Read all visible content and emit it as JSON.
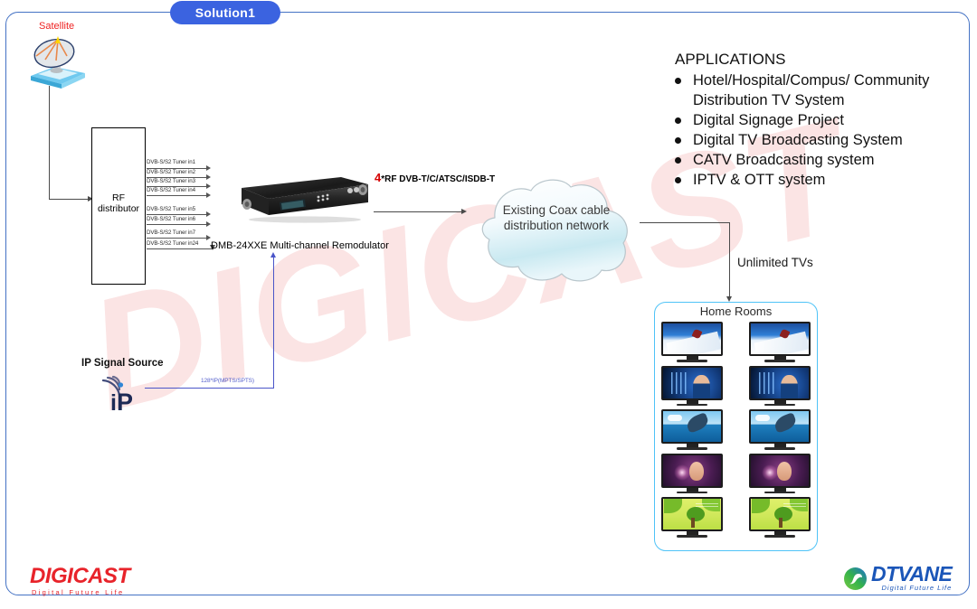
{
  "badge": {
    "label": "Solution1"
  },
  "satellite": {
    "label": "Satellite"
  },
  "rf_distributor": {
    "line1": "RF",
    "line2": "distributor"
  },
  "tuner_inputs": [
    "DVB-S/S2 Tuner in1",
    "DVB-S/S2 Tuner in2",
    "DVB-S/S2 Tuner in3",
    "DVB-S/S2 Tuner in4",
    "DVB-S/S2 Tuner in5",
    "DVB-S/S2 Tuner in6",
    "DVB-S/S2 Tuner in7",
    "DVB-S/S2 Tuner in24"
  ],
  "device": {
    "label": "DMB-24XXE Multi-channel Remodulator"
  },
  "rf_output": {
    "count": "4",
    "label": "*RF DVB-T/C/ATSC/ISDB-T"
  },
  "cloud": {
    "line1": "Existing Coax cable",
    "line2": "distribution network"
  },
  "unlimited": {
    "label": "Unlimited TVs"
  },
  "ip_source": {
    "label": "IP Signal Source",
    "icon": "ip-antenna-icon",
    "stream_count": "128*IP(MPTS/SPTS)"
  },
  "applications": {
    "title": "APPLICATIONS",
    "items": [
      "Hotel/Hospital/Compus/ Community Distribution TV System",
      "Digital Signage Project",
      "Digital TV Broadcasting System",
      "CATV Broadcasting system",
      "IPTV & OTT system"
    ]
  },
  "home_rooms": {
    "title": "Home Rooms",
    "tvs": [
      {
        "scene": "ski"
      },
      {
        "scene": "ski"
      },
      {
        "scene": "woman"
      },
      {
        "scene": "woman"
      },
      {
        "scene": "dolphin"
      },
      {
        "scene": "dolphin"
      },
      {
        "scene": "girl"
      },
      {
        "scene": "girl"
      },
      {
        "scene": "tree"
      },
      {
        "scene": "tree"
      }
    ]
  },
  "watermark": {
    "text": "DIGICAST"
  },
  "logo_left": {
    "name": "DIGICAST",
    "tagline": "Digital Future Life"
  },
  "logo_right": {
    "name": "DTVANE",
    "tagline": "Digital  Future  Life"
  },
  "colors": {
    "badge_blue": "#3b63e0",
    "frame_blue": "#4472c4",
    "accent_red": "#d50000",
    "rooms_border": "#4fc3f7",
    "ip_blue": "#5560cc",
    "digicast_red": "#e8232a",
    "dtvane_blue": "#1b56b8"
  }
}
